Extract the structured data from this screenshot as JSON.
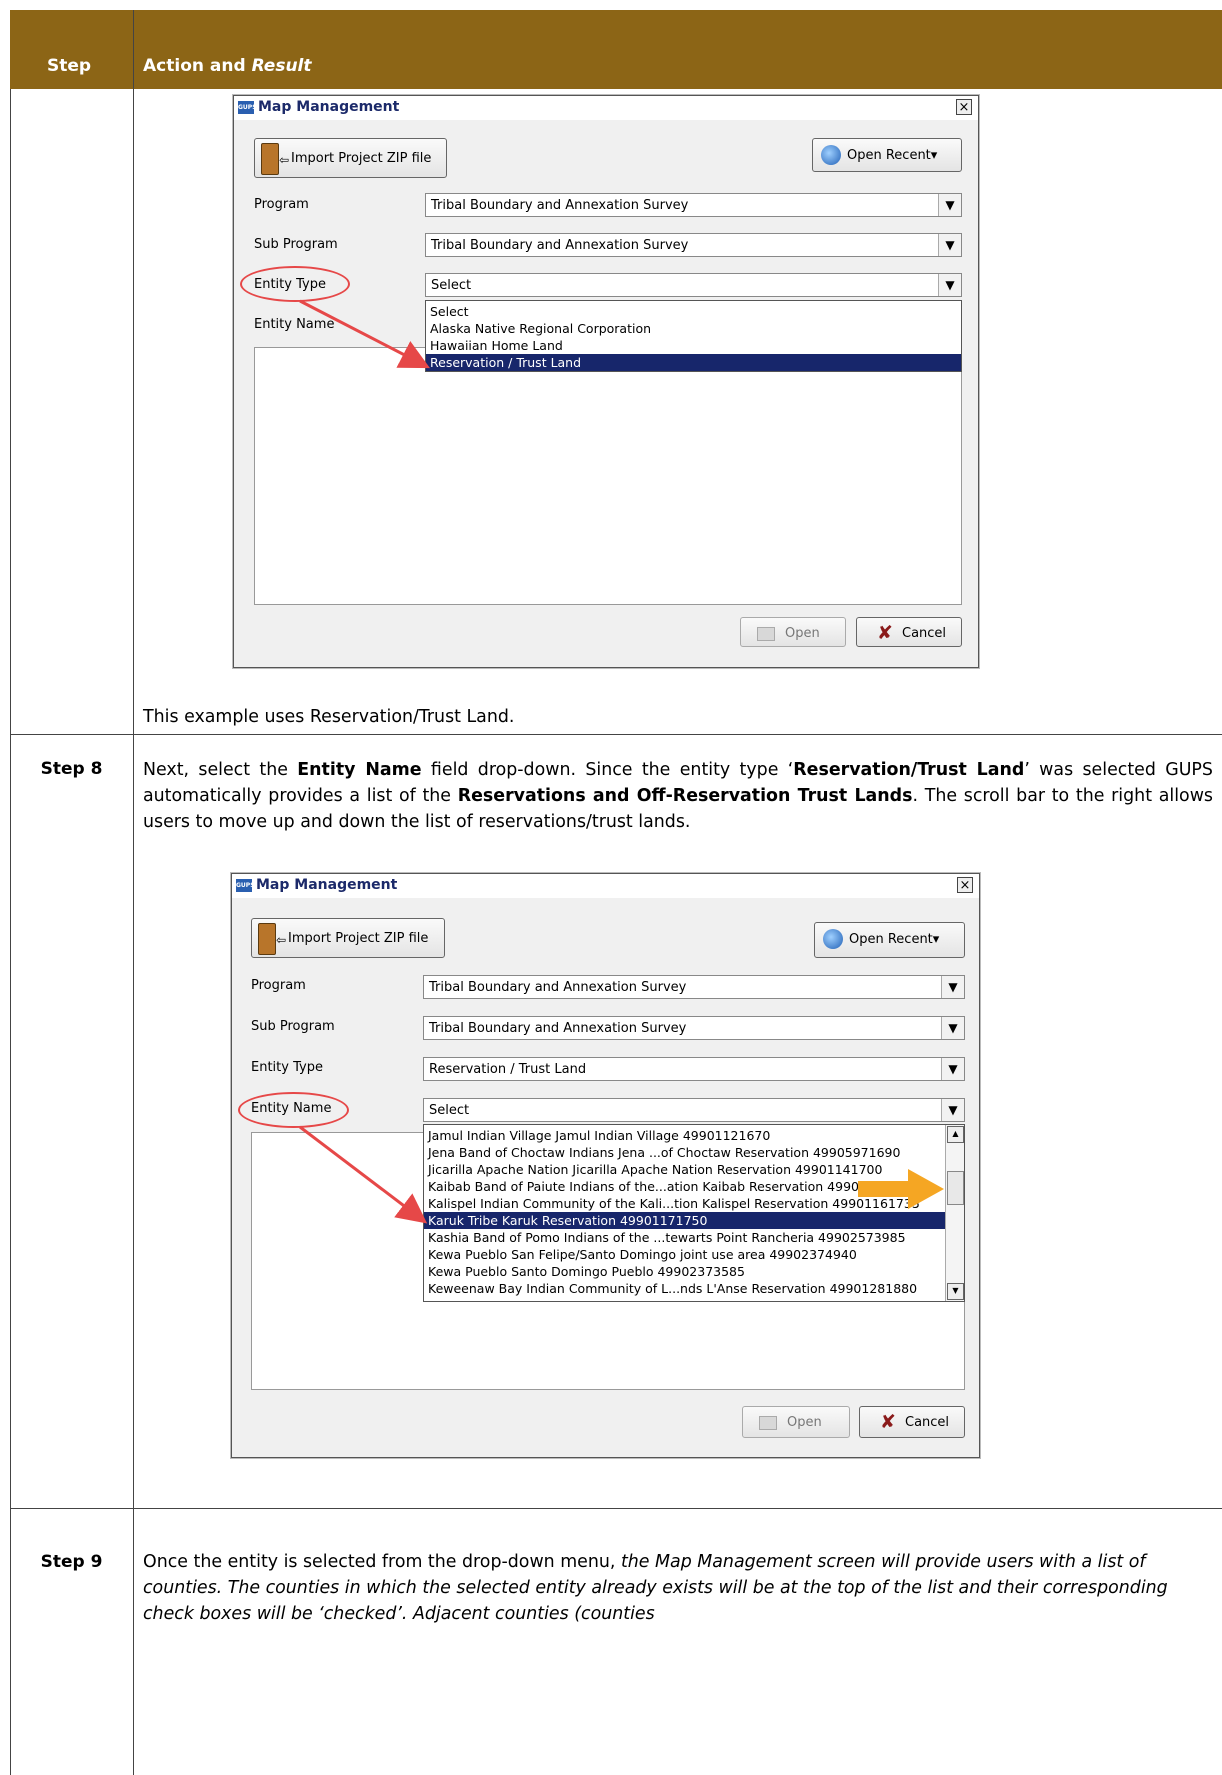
{
  "header": {
    "step": "Step",
    "action": "Action and ",
    "result": "Result"
  },
  "row1_caption": "This example uses Reservation/Trust Land.",
  "step8": {
    "label": "Step 8",
    "t1": "Next, select the ",
    "b1": "Entity Name",
    "t2": " field drop-down. Since the entity type ‘",
    "b2": "Reservation/Trust Land",
    "t3": "’ was selected GUPS automatically provides a list of the ",
    "b3": "Reservations and Off-Reservation Trust Lands",
    "t4": ". The scroll bar to the right allows users to move up and down the list of reservations/trust lands."
  },
  "step9": {
    "label": "Step 9",
    "t1": "Once the entity is selected from the drop-down menu, ",
    "i1": "the Map Management screen will provide users with a list of counties. The counties in which the selected entity already exists will be at the top of the list and their corresponding check boxes will be ‘checked’. Adjacent counties (counties"
  },
  "dialog1": {
    "title": "Map Management",
    "logo": "GUPS",
    "close": "☒",
    "import_label": "Import Project ZIP file",
    "recent_label": "Open Recent",
    "program_label": "Program",
    "program_value": "Tribal Boundary and Annexation Survey",
    "subprogram_label": "Sub Program",
    "subprogram_value": "Tribal Boundary and Annexation Survey",
    "entitytype_label": "Entity Type",
    "entitytype_value": "Select",
    "entityname_label": "Entity Name",
    "dropdown_options": [
      "Select",
      "Alaska Native Regional Corporation",
      "Hawaiian Home Land",
      "Reservation / Trust Land"
    ],
    "selected_index": 3,
    "open_label": "Open",
    "cancel_label": "Cancel"
  },
  "dialog2": {
    "title": "Map Management",
    "logo": "GUPS",
    "close": "☒",
    "import_label": "Import Project ZIP file",
    "recent_label": "Open Recent",
    "program_label": "Program",
    "program_value": "Tribal Boundary and Annexation Survey",
    "subprogram_label": "Sub Program",
    "subprogram_value": "Tribal Boundary and Annexation Survey",
    "entitytype_label": "Entity Type",
    "entitytype_value": "Reservation / Trust Land",
    "entityname_label": "Entity Name",
    "entityname_value": "Select",
    "dropdown_options": [
      "Jamul Indian Village Jamul Indian Village 49901121670",
      "Jena Band of Choctaw Indians Jena ...of Choctaw Reservation 49905971690",
      "Jicarilla Apache Nation Jicarilla Apache Nation Reservation 49901141700",
      "Kaibab Band of Paiute Indians of the...ation Kaibab Reservation 49901151720",
      "Kalispel Indian Community of the Kali...tion Kalispel Reservation 49901161735",
      "Karuk Tribe Karuk Reservation 49901171750",
      "Kashia Band of Pomo Indians of the ...tewarts Point Rancheria 49902573985",
      "Kewa Pueblo San Felipe/Santo Domingo joint use area 49902374940",
      "Kewa Pueblo Santo Domingo Pueblo 49902373585",
      "Keweenaw Bay Indian Community of L...nds L'Anse Reservation 49901281880"
    ],
    "selected_index": 5,
    "open_label": "Open",
    "cancel_label": "Cancel"
  },
  "colors": {
    "header_bg": "#8c6516",
    "highlight": "#e64848",
    "selection": "#17266b",
    "arrow": "#f5a623"
  }
}
